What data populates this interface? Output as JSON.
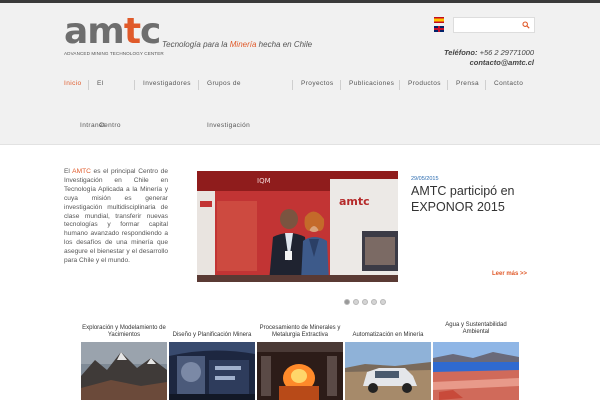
{
  "logo": {
    "word_a": "amc",
    "word_prefix": "am",
    "word_t": "t",
    "word_c": "c",
    "subtitle": "ADVANCED MINING TECHNOLOGY CENTER"
  },
  "tagline": {
    "before": "Tecnología para la ",
    "highlight": "Minería",
    "after": " hecha en Chile"
  },
  "languages": [
    "Español",
    "English"
  ],
  "search": {
    "placeholder": "",
    "value": ""
  },
  "contact": {
    "phone_label": "Teléfono:",
    "phone": "+56 2 29771000",
    "email": "contacto@amtc.cl"
  },
  "nav": {
    "items": [
      {
        "label": "Inicio",
        "active": true
      },
      {
        "label": "El"
      },
      {
        "label": "Centro"
      },
      {
        "label": "Investigadores"
      },
      {
        "label": "Grupos de"
      },
      {
        "label": "Investigación"
      },
      {
        "label": "Intranet"
      },
      {
        "label": "Proyectos"
      },
      {
        "label": "Publicaciones"
      },
      {
        "label": "Productos"
      },
      {
        "label": "Prensa"
      },
      {
        "label": "Contacto"
      }
    ]
  },
  "intro": {
    "prefix": "El ",
    "brand": "AMTC",
    "text": " es el principal Centro de Investigación en Chile en Tecnología Aplicada a la Minería y cuya misión es generar investigación multidisciplinaria de clase mundial, transferir nuevas tecnologías y formar capital humano avanzado respondiendo a los desafíos de una minería que asegure el bienestar y el desarrollo para Chile y el mundo."
  },
  "slider": {
    "date": "29/05/2015",
    "title": "AMTC participó en EXPONOR 2015",
    "read_more": "Leer más >>",
    "slide_count": 5,
    "active_slide": 1,
    "booth_logo": "amtc",
    "banner_text": "IQM"
  },
  "cards": [
    {
      "title": "Exploración y Modelamiento de Yacimientos",
      "icon": "mountain-landscape-image"
    },
    {
      "title": "Diseño y Planificación Minera",
      "icon": "mining-tunnel-machine-image"
    },
    {
      "title": "Procesamiento de Minerales y Metalurgia Extractiva",
      "icon": "molten-metal-image"
    },
    {
      "title": "Automatización en Minería",
      "icon": "autonomous-vehicle-image"
    },
    {
      "title": "Agua y Sustentabilidad Ambiental",
      "icon": "salt-lake-image"
    }
  ],
  "colors": {
    "accent": "#e05a2a",
    "header_bg": "#f1f1f1",
    "text": "#555555",
    "date_blue": "#2a6bb0"
  }
}
